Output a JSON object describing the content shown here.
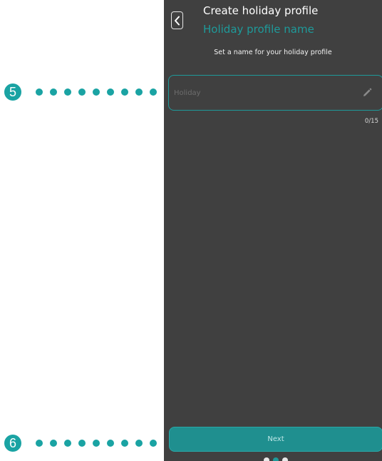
{
  "header": {
    "title": "Create holiday profile",
    "subtitle": "Holiday profile name"
  },
  "form": {
    "instruction": "Set a name for your holiday profile",
    "name_placeholder": "Holiday",
    "name_value": "",
    "char_counter": "0/15"
  },
  "actions": {
    "next_label": "Next"
  },
  "pager": {
    "total_steps": 3,
    "current_step": 2
  },
  "callouts": [
    {
      "number": "5",
      "target": "profile-name-input"
    },
    {
      "number": "6",
      "target": "next-button"
    }
  ],
  "colors": {
    "background": "#404040",
    "accent": "#1e9a9a",
    "callout": "#1aa3a3"
  },
  "icons": {
    "back": "chevron-left-icon",
    "edit": "pencil-icon"
  }
}
